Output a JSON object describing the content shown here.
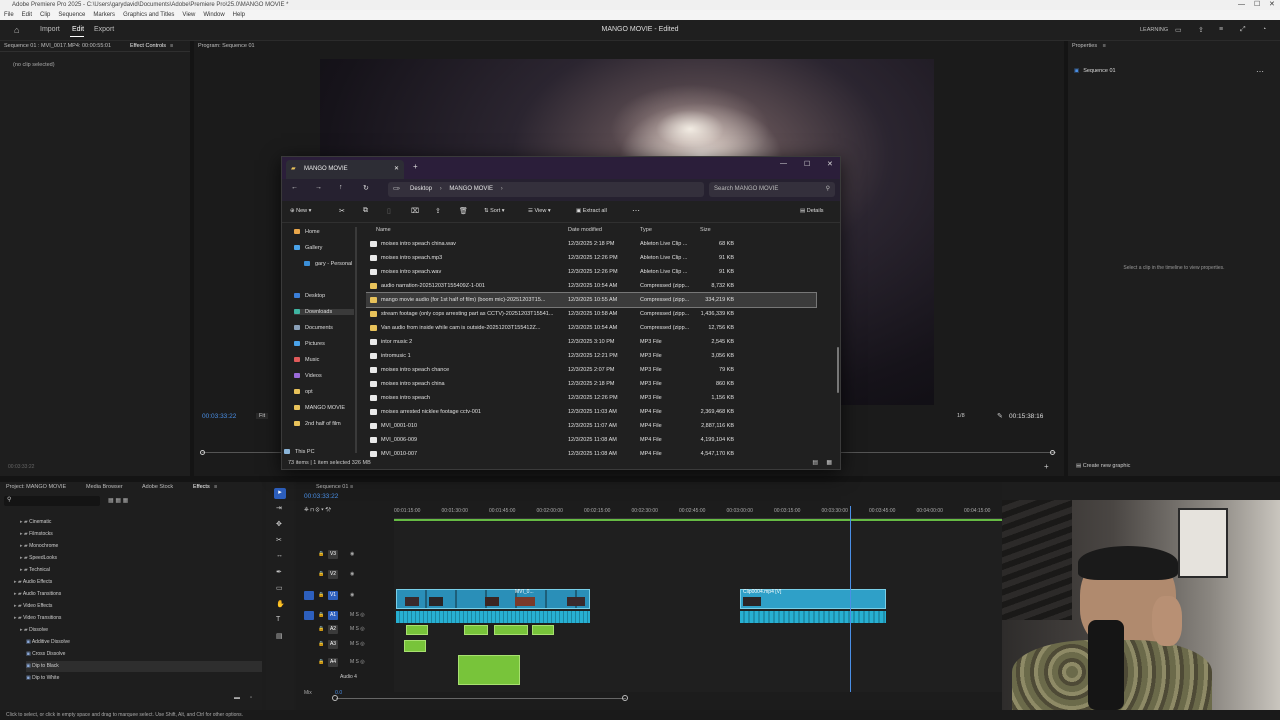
{
  "window": {
    "title": "Adobe Premiere Pro 2025 - C:\\Users\\garydavid\\Documents\\Adobe\\Premiere Pro\\25.0\\MANGO MOVIE *",
    "menu": [
      "File",
      "Edit",
      "Clip",
      "Sequence",
      "Markers",
      "Graphics and Titles",
      "View",
      "Window",
      "Help"
    ]
  },
  "app_header": {
    "tabs": [
      "Import",
      "Edit",
      "Export"
    ],
    "active_tab": "Edit",
    "project_title": "MANGO MOVIE - Edited",
    "learning_label": "LEARNING"
  },
  "source_panel": {
    "sequence_label": "Sequence 01 : MVI_0017.MP4: 00:00:55:01",
    "tab_label": "Effect Controls",
    "empty_text": "(no clip selected)",
    "timecode": "00:03:33:22"
  },
  "program_monitor": {
    "title": "Program: Sequence 01",
    "timecode": "00:03:33:22",
    "fit_label": "Fit",
    "ratio": "1/8",
    "duration": "00:15:38:16"
  },
  "properties_panel": {
    "title": "Properties",
    "item": "Sequence 01",
    "hint": "Select a clip in the timeline to view properties.",
    "create_graphic": "Create new graphic"
  },
  "explorer": {
    "tab_title": "MANGO MOVIE",
    "breadcrumb": [
      "Desktop",
      "MANGO MOVIE"
    ],
    "search_placeholder": "Search MANGO MOVIE",
    "toolbar": {
      "new": "New",
      "sort": "Sort",
      "view": "View",
      "extract": "Extract all",
      "details": "Details"
    },
    "sidebar": [
      {
        "label": "Home",
        "color": "#e9a64a"
      },
      {
        "label": "Gallery",
        "color": "#4aa3e9"
      },
      {
        "label": "gary - Personal",
        "color": "#3b8fd8"
      },
      {
        "label": "Desktop",
        "color": "#3b7fd8"
      },
      {
        "label": "Downloads",
        "color": "#3fb5a2"
      },
      {
        "label": "Documents",
        "color": "#8aa0b8"
      },
      {
        "label": "Pictures",
        "color": "#4aa3e9"
      },
      {
        "label": "Music",
        "color": "#e05a5a"
      },
      {
        "label": "Videos",
        "color": "#9a6ad8"
      },
      {
        "label": "opt",
        "color": "#e8c25a"
      },
      {
        "label": "MANGO MOVIE",
        "color": "#e8c25a"
      },
      {
        "label": "2nd half of film",
        "color": "#e8c25a"
      },
      {
        "label": "This PC",
        "color": "#8ab4d8"
      }
    ],
    "columns": [
      "Name",
      "Date modified",
      "Type",
      "Size"
    ],
    "files": [
      {
        "name": "moises intro speach china.wav",
        "date": "12/3/2025 2:18 PM",
        "type": "Ableton Live Clip ...",
        "size": "68 KB",
        "kind": "file"
      },
      {
        "name": "moises intro speach.mp3",
        "date": "12/3/2025 12:26 PM",
        "type": "Ableton Live Clip ...",
        "size": "91 KB",
        "kind": "file"
      },
      {
        "name": "moises intro speach.wav",
        "date": "12/3/2025 12:26 PM",
        "type": "Ableton Live Clip ...",
        "size": "91 KB",
        "kind": "file"
      },
      {
        "name": "audio narration-20251203T155409Z-1-001",
        "date": "12/3/2025 10:54 AM",
        "type": "Compressed (zipp...",
        "size": "8,732 KB",
        "kind": "zip"
      },
      {
        "name": "mango movie audio (for 1st half of film) (boom mic)-20251203T15...",
        "date": "12/3/2025 10:55 AM",
        "type": "Compressed (zipp...",
        "size": "334,219 KB",
        "kind": "zip",
        "selected": true
      },
      {
        "name": "stream footage (only cops arresting part as CCTV)-20251203T15541...",
        "date": "12/3/2025 10:58 AM",
        "type": "Compressed (zipp...",
        "size": "1,436,339 KB",
        "kind": "zip"
      },
      {
        "name": "Van audio from inside while cam is outside-20251203T155412Z...",
        "date": "12/3/2025 10:54 AM",
        "type": "Compressed (zipp...",
        "size": "12,756 KB",
        "kind": "zip"
      },
      {
        "name": "intor music 2",
        "date": "12/3/2025 3:10 PM",
        "type": "MP3 File",
        "size": "2,545 KB",
        "kind": "file"
      },
      {
        "name": "intromusic 1",
        "date": "12/3/2025 12:21 PM",
        "type": "MP3 File",
        "size": "3,056 KB",
        "kind": "file"
      },
      {
        "name": "moises intro speach chance",
        "date": "12/3/2025 2:07 PM",
        "type": "MP3 File",
        "size": "79 KB",
        "kind": "file"
      },
      {
        "name": "moises intro speach china",
        "date": "12/3/2025 2:18 PM",
        "type": "MP3 File",
        "size": "860 KB",
        "kind": "file"
      },
      {
        "name": "moises intro speach",
        "date": "12/3/2025 12:26 PM",
        "type": "MP3 File",
        "size": "1,156 KB",
        "kind": "file"
      },
      {
        "name": "moises arrested nicklee footage cctv-001",
        "date": "12/3/2025 11:03 AM",
        "type": "MP4 File",
        "size": "2,369,468 KB",
        "kind": "file"
      },
      {
        "name": "MVI_0001-010",
        "date": "12/3/2025 11:07 AM",
        "type": "MP4 File",
        "size": "2,887,116 KB",
        "kind": "file"
      },
      {
        "name": "MVI_0006-009",
        "date": "12/3/2025 11:08 AM",
        "type": "MP4 File",
        "size": "4,199,104 KB",
        "kind": "file"
      },
      {
        "name": "MVI_0010-007",
        "date": "12/3/2025 11:08 AM",
        "type": "MP4 File",
        "size": "4,547,170 KB",
        "kind": "file"
      }
    ],
    "status": "73 items  |  1 item selected  326 MB"
  },
  "project_panel": {
    "tabs": [
      "Project: MANGO MOVIE",
      "Media Browser",
      "Adobe Stock",
      "Effects"
    ],
    "tree": [
      "Cinematic",
      "Filmstocks",
      "Monochrome",
      "SpeedLooks",
      "Technical",
      "Audio Effects",
      "Audio Transitions",
      "Video Effects",
      "Video Transitions",
      "Dissolve",
      "Additive Dissolve",
      "Cross Dissolve",
      "Dip to Black",
      "Dip to White"
    ]
  },
  "timeline": {
    "tab": "Sequence 01",
    "timecode": "00:03:33:22",
    "ruler": [
      "00:01:15:00",
      "00:01:30:00",
      "00:01:45:00",
      "00:02:00:00",
      "00:02:15:00",
      "00:02:30:00",
      "00:02:45:00",
      "00:03:00:00",
      "00:03:15:00",
      "00:03:30:00",
      "00:03:45:00",
      "00:04:00:00",
      "00:04:15:00"
    ],
    "tracks": [
      "V3",
      "V2",
      "V1",
      "A1",
      "A2",
      "A3",
      "A4"
    ],
    "clip_v1": "MVI_0...",
    "clip_v2": "Clip0004.mp4 [V]",
    "audio4_label": "Audio 4",
    "mix_label": "Mix",
    "mix_value": "0.0"
  },
  "status_bar": "Click to select, or click in empty space and drag to marquee select. Use Shift, Alt, and Ctrl for other options.",
  "colors": {
    "accent": "#2d8ceb",
    "clip_video": "#2fa0c8",
    "clip_audio_green": "#78c43a",
    "selection": "#3b3b3b"
  }
}
